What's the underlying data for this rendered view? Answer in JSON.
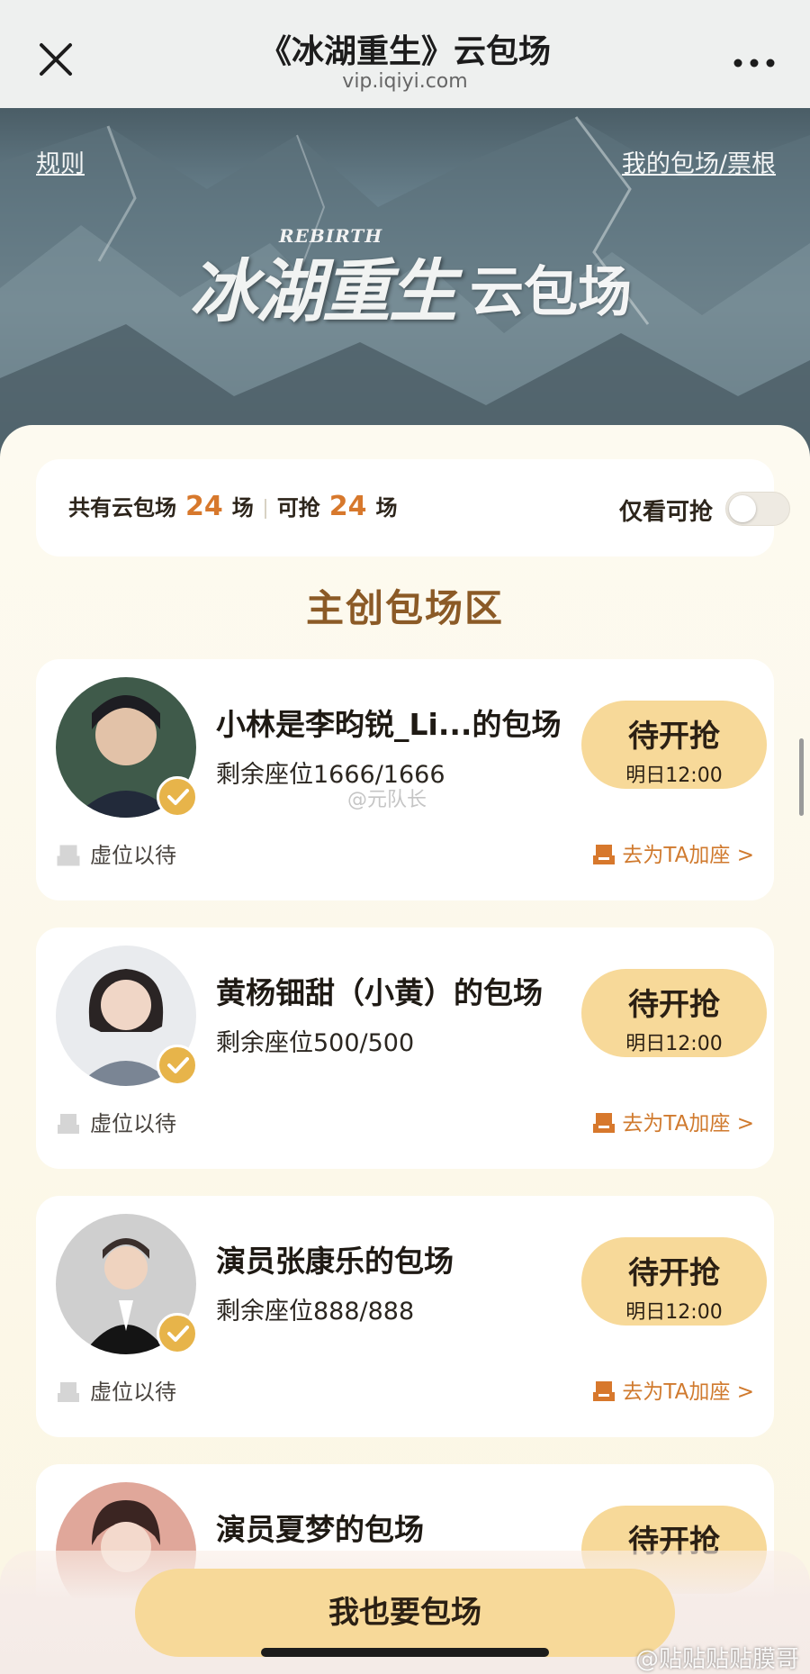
{
  "nav": {
    "title": "《冰湖重生》云包场",
    "subtitle": "vip.iqiyi.com"
  },
  "banner": {
    "rules": "规则",
    "my_booking": "我的包场/票根",
    "logo_title": "冰湖重生",
    "logo_en": "REBIRTH",
    "logo_side": "云包场"
  },
  "summary": {
    "total_label": "共有云包场",
    "total_count": "24",
    "unit": "场",
    "available_label": "可抢",
    "available_count": "24",
    "filter_label": "仅看可抢",
    "filter_on": false
  },
  "section": {
    "title": "主创包场区"
  },
  "cards": [
    {
      "name": "小林是李昀锐_Li...的包场",
      "seats": "剩余座位1666/1666",
      "button": "待开抢",
      "time": "明日12:00",
      "hold": "虚位以待",
      "add_seat": "去为TA加座 >"
    },
    {
      "name": "黄杨钿甜（小黄）的包场",
      "seats": "剩余座位500/500",
      "button": "待开抢",
      "time": "明日12:00",
      "hold": "虚位以待",
      "add_seat": "去为TA加座 >"
    },
    {
      "name": "演员张康乐的包场",
      "seats": "剩余座位888/888",
      "button": "待开抢",
      "time": "明日12:00",
      "hold": "虚位以待",
      "add_seat": "去为TA加座 >"
    },
    {
      "name": "演员夏梦的包场",
      "button": "待开抢"
    }
  ],
  "cta": {
    "label": "我也要包场"
  },
  "watermarks": {
    "center": "@元队长",
    "corner": "@贴贴贴贴膜哥"
  },
  "colors": {
    "accent_orange": "#d7782c",
    "button_yellow": "#f7d999",
    "section_brown": "#8b5a26"
  }
}
